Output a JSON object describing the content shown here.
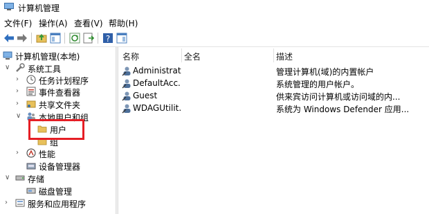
{
  "window": {
    "title": "计算机管理"
  },
  "menu": [
    "文件(F)",
    "操作(A)",
    "查看(V)",
    "帮助(H)"
  ],
  "tree": {
    "root": "计算机管理(本地)",
    "system_tools": "系统工具",
    "task_scheduler": "任务计划程序",
    "event_viewer": "事件查看器",
    "shared_folders": "共享文件夹",
    "local_users_groups": "本地用户和组",
    "users": "用户",
    "groups": "组",
    "performance": "性能",
    "device_manager": "设备管理器",
    "storage": "存储",
    "disk_management": "磁盘管理",
    "services_apps": "服务和应用程序"
  },
  "list": {
    "headers": {
      "name": "名称",
      "fullname": "全名",
      "description": "描述"
    },
    "rows": [
      {
        "name": "Administrat...",
        "fullname": "",
        "description": "管理计算机(域)的内置帐户"
      },
      {
        "name": "DefaultAcc...",
        "fullname": "",
        "description": "系统管理的用户帐户。"
      },
      {
        "name": "Guest",
        "fullname": "",
        "description": "供来宾访问计算机或访问域的内..."
      },
      {
        "name": "WDAGUtilit...",
        "fullname": "",
        "description": "系统为 Windows Defender 应用..."
      }
    ]
  },
  "colors": {
    "highlight": "#e51e25",
    "folder": "#e8c15b"
  }
}
